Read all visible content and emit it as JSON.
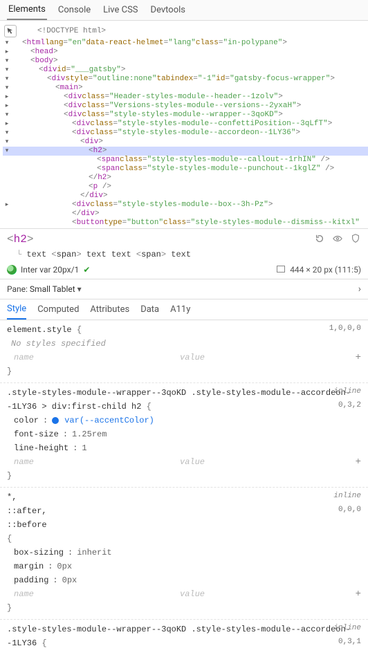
{
  "topbar": {
    "tabs": [
      "Elements",
      "Console",
      "Live CSS",
      "Devtools"
    ],
    "active": 0
  },
  "dom": [
    {
      "indent": 0,
      "twisty": "",
      "raw": "<!DOCTYPE html>",
      "kind": "doctype"
    },
    {
      "indent": 0,
      "twisty": "▾",
      "tag": "html",
      "attrs": [
        [
          "lang",
          "en"
        ],
        [
          "data-react-helmet",
          "lang"
        ],
        [
          "class",
          "in-polypane"
        ]
      ],
      "open": true
    },
    {
      "indent": 1,
      "twisty": "▸",
      "tag": "head",
      "open": true
    },
    {
      "indent": 1,
      "twisty": "▾",
      "tag": "body",
      "open": true
    },
    {
      "indent": 2,
      "twisty": "▾",
      "tag": "div",
      "attrs": [
        [
          "id",
          "___gatsby"
        ]
      ],
      "open": true
    },
    {
      "indent": 3,
      "twisty": "▾",
      "tag": "div",
      "attrs": [
        [
          "style",
          "outline:none"
        ],
        [
          "tabindex",
          "-1"
        ],
        [
          "id",
          "gatsby-focus-wrapper"
        ]
      ],
      "open": true
    },
    {
      "indent": 4,
      "twisty": "▾",
      "tag": "main",
      "open": true
    },
    {
      "indent": 5,
      "twisty": "▸",
      "tag": "div",
      "attrs": [
        [
          "class",
          "Header-styles-module--header--1zolv"
        ]
      ],
      "open": true
    },
    {
      "indent": 5,
      "twisty": "▸",
      "tag": "div",
      "attrs": [
        [
          "class",
          "Versions-styles-module--versions--2yxaH"
        ]
      ],
      "open": true
    },
    {
      "indent": 5,
      "twisty": "▾",
      "tag": "div",
      "attrs": [
        [
          "class",
          "style-styles-module--wrapper--3qoKD"
        ]
      ],
      "open": true
    },
    {
      "indent": 6,
      "twisty": "▸",
      "tag": "div",
      "attrs": [
        [
          "class",
          "style-styles-module--confettiPosition--3qLfT"
        ]
      ],
      "open": true
    },
    {
      "indent": 6,
      "twisty": "▾",
      "tag": "div",
      "attrs": [
        [
          "class",
          "style-styles-module--accordeon--1LY36"
        ]
      ],
      "open": true
    },
    {
      "indent": 7,
      "twisty": "▾",
      "tag": "div",
      "open": true
    },
    {
      "indent": 8,
      "twisty": "▾",
      "tag": "h2",
      "open": true,
      "selected": true
    },
    {
      "indent": 9,
      "twisty": "",
      "tag": "span",
      "attrs": [
        [
          "class",
          "style-styles-module--callout--1rhIN"
        ]
      ],
      "self": true
    },
    {
      "indent": 9,
      "twisty": "",
      "tag": "span",
      "attrs": [
        [
          "class",
          "style-styles-module--punchout--1kglZ"
        ]
      ],
      "self": true
    },
    {
      "indent": 8,
      "twisty": "",
      "close": "h2"
    },
    {
      "indent": 8,
      "twisty": "",
      "tag": "p",
      "self": true
    },
    {
      "indent": 7,
      "twisty": "",
      "close": "div"
    },
    {
      "indent": 6,
      "twisty": "▸",
      "tag": "div",
      "attrs": [
        [
          "class",
          "style-styles-module--box--3h-Pz"
        ]
      ],
      "open": true
    },
    {
      "indent": 6,
      "twisty": "",
      "close": "div"
    },
    {
      "indent": 6,
      "twisty": "",
      "tag": "button",
      "attrs": [
        [
          "type",
          "button"
        ],
        [
          "class",
          "style-styles-module--dismiss--kitxl"
        ]
      ],
      "trail": " />",
      "partial": true
    }
  ],
  "selected": {
    "tag": "h2",
    "path": [
      "text",
      "<span>",
      "text",
      "text",
      "<span>",
      "text"
    ],
    "path_raw": "text <span> text text <span> text",
    "font": "Inter var 20px/1",
    "dims": "444 × 20 px (111:5)"
  },
  "pane": {
    "label": "Pane:",
    "value": "Small Tablet"
  },
  "styles_tabs": {
    "tabs": [
      "Style",
      "Computed",
      "Attributes",
      "Data",
      "A11y"
    ],
    "active": 0
  },
  "rules": [
    {
      "selector": "element.style",
      "origin": "",
      "specificity": "1,0,0,0",
      "empty_text": "No styles specified",
      "decls": [],
      "addable": true
    },
    {
      "selector": ".style-styles-module--wrapper--3qoKD .style-styles-module--accordeon--1LY36 > div:first-child h2",
      "origin": "inline",
      "specificity": "0,3,2",
      "decls": [
        {
          "prop": "color",
          "val": "var(--accentColor)",
          "swatch": "#1a73e8",
          "accent": true
        },
        {
          "prop": "font-size",
          "val": "1.25rem"
        },
        {
          "prop": "line-height",
          "val": "1"
        }
      ],
      "addable": true
    },
    {
      "selector_lines": [
        "*,",
        "::after,",
        "::before"
      ],
      "origin": "inline",
      "specificity": "0,0,0",
      "decls": [
        {
          "prop": "box-sizing",
          "val": "inherit"
        },
        {
          "prop": "margin",
          "val": "0px"
        },
        {
          "prop": "padding",
          "val": "0px"
        }
      ],
      "addable": true
    },
    {
      "selector": ".style-styles-module--wrapper--3qoKD .style-styles-module--accordeon--1LY36",
      "origin": "inline",
      "specificity": "0,3,1",
      "decls": [],
      "addable": false,
      "truncated": true
    }
  ],
  "kv_placeholder": {
    "name": "name",
    "value": "value"
  }
}
